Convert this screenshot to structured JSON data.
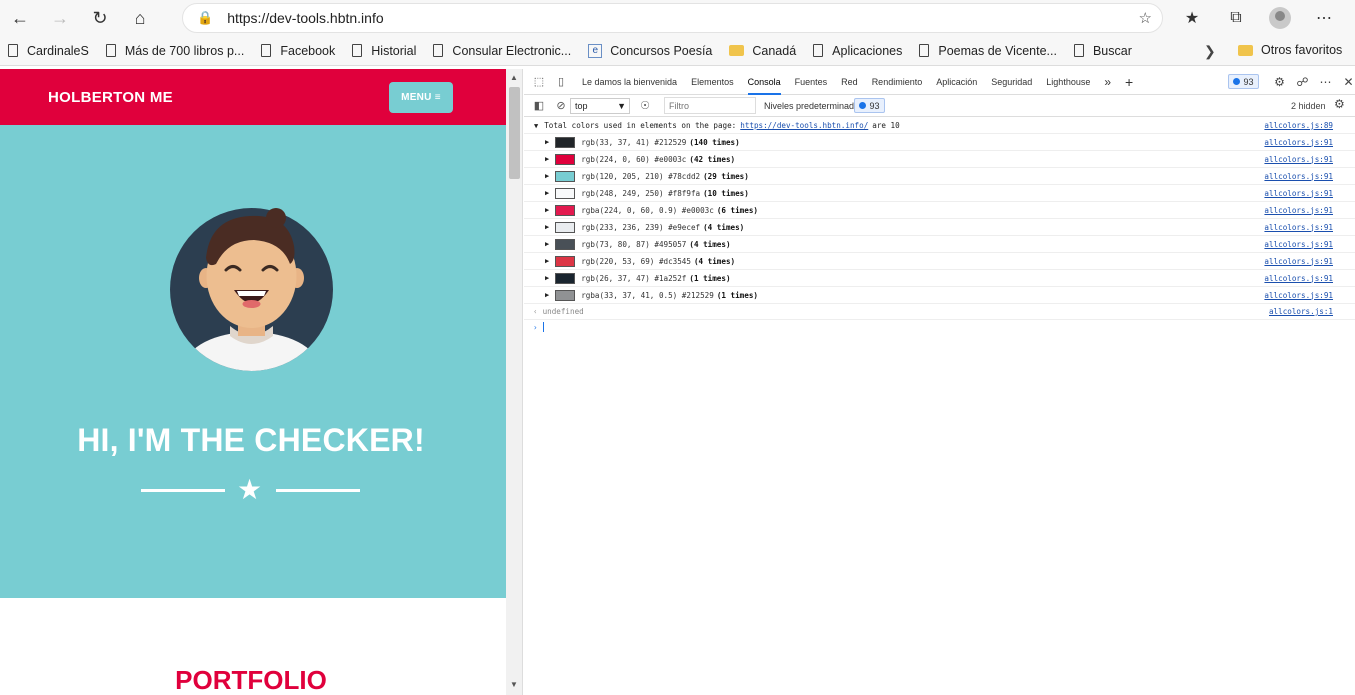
{
  "browser": {
    "url": "https://dev-tools.hbtn.info",
    "bookmarks": [
      "CardinaleS",
      "Más de 700 libros p...",
      "Facebook",
      "Historial",
      "Consular Electronic...",
      "Concursos Poesía",
      "Canadá",
      "Aplicaciones",
      "Poemas de Vicente...",
      "Buscar"
    ],
    "other_favorites": "Otros favoritos"
  },
  "site": {
    "brand": "HOLBERTON ME",
    "menu_label": "MENU ≡",
    "hero_title": "HI, I'M THE CHECKER!",
    "section_title": "PORTFOLIO"
  },
  "devtools": {
    "tabs": [
      "Le damos la bienvenida",
      "Elementos",
      "Consola",
      "Fuentes",
      "Red",
      "Rendimiento",
      "Aplicación",
      "Seguridad",
      "Lighthouse"
    ],
    "active_tab": "Consola",
    "issues_count": "93",
    "context": "top",
    "filter_placeholder": "Filtro",
    "levels": "Niveles predeterminados",
    "hidden": "2 hidden",
    "log_prefix": "Total colors used in elements on the page:",
    "log_link": "https://dev-tools.hbtn.info/",
    "log_suffix": "are 10",
    "log_source": "allcolors.js:89",
    "colors": [
      {
        "text": "rgb(33, 37, 41) #212529",
        "count": "(140 times)",
        "hex": "#212529",
        "source": "allcolors.js:91"
      },
      {
        "text": "rgb(224, 0, 60) #e0003c",
        "count": "(42 times)",
        "hex": "#e0003c",
        "source": "allcolors.js:91"
      },
      {
        "text": "rgb(120, 205, 210) #78cdd2",
        "count": "(29 times)",
        "hex": "#78cdd2",
        "source": "allcolors.js:91"
      },
      {
        "text": "rgb(248, 249, 250) #f8f9fa",
        "count": "(10 times)",
        "hex": "#f8f9fa",
        "source": "allcolors.js:91"
      },
      {
        "text": "rgba(224, 0, 60, 0.9) #e0003c",
        "count": "(6 times)",
        "hex": "#e31a4f",
        "source": "allcolors.js:91"
      },
      {
        "text": "rgb(233, 236, 239) #e9ecef",
        "count": "(4 times)",
        "hex": "#e9ecef",
        "source": "allcolors.js:91"
      },
      {
        "text": "rgb(73, 80, 87) #495057",
        "count": "(4 times)",
        "hex": "#495057",
        "source": "allcolors.js:91"
      },
      {
        "text": "rgb(220, 53, 69) #dc3545",
        "count": "(4 times)",
        "hex": "#dc3545",
        "source": "allcolors.js:91"
      },
      {
        "text": "rgb(26, 37, 47) #1a252f",
        "count": "(1 times)",
        "hex": "#1a252f",
        "source": "allcolors.js:91"
      },
      {
        "text": "rgba(33, 37, 41, 0.5) #212529",
        "count": "(1 times)",
        "hex": "#909294",
        "source": "allcolors.js:91"
      }
    ],
    "return_value": "undefined",
    "return_source": "allcolors.js:1"
  },
  "theme": {
    "brand_red": "#e0003c",
    "teal": "#78cdd2",
    "link_blue": "#1a4fae"
  }
}
